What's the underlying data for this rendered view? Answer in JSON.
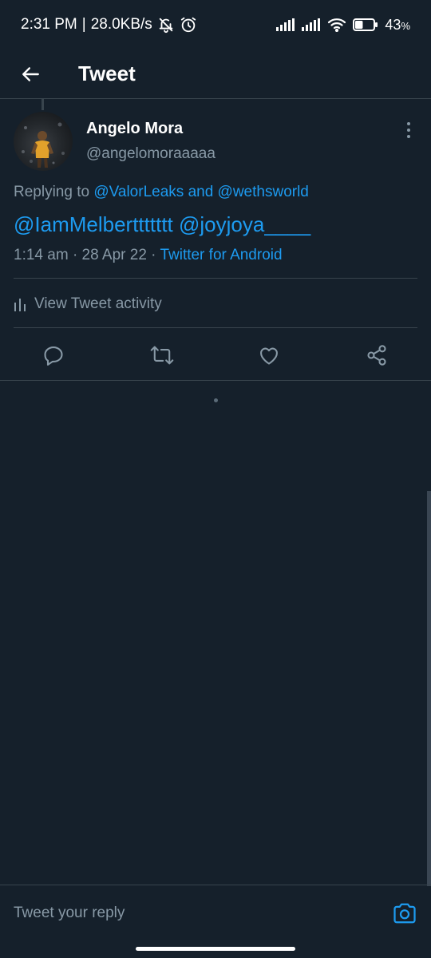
{
  "status_bar": {
    "time": "2:31 PM",
    "separator": "|",
    "network_speed": "28.0KB/s",
    "battery": "43",
    "battery_unit": "%",
    "icons": [
      "silent-icon",
      "alarm-icon",
      "signal-icon",
      "signal-icon",
      "wifi-icon",
      "battery-icon"
    ]
  },
  "header": {
    "title": "Tweet",
    "back_icon": "arrow-left-icon"
  },
  "tweet": {
    "author_name": "Angelo Mora",
    "author_handle": "@angelomoraaaaa",
    "replying_prefix": "Replying to",
    "replying_user_1": "@ValorLeaks",
    "replying_and": "and",
    "replying_user_2": "@wethsworld",
    "mention_1": "@IamMelberttttttt",
    "mention_2": "@joyjoya____",
    "time": "1:14 am",
    "date": "28 Apr 22",
    "dot": "·",
    "source": "Twitter for Android",
    "activity_label": "View Tweet activity"
  },
  "actions": {
    "icons": [
      "reply-icon",
      "retweet-icon",
      "like-icon",
      "share-icon"
    ]
  },
  "reply_bar": {
    "placeholder": "Tweet your reply",
    "camera_icon": "camera-icon"
  },
  "colors": {
    "background": "#15202b",
    "accent": "#1d9bf0",
    "secondary_text": "#8899a6",
    "divider": "#38444d"
  }
}
